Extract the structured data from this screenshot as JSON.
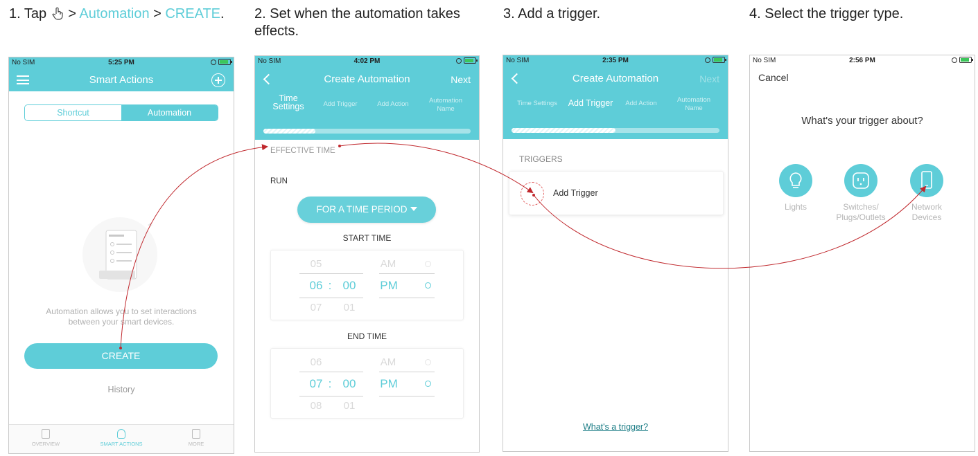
{
  "steps": {
    "s1": {
      "prefix": "1. Tap ",
      "sep1": " > ",
      "automation": "Automation",
      "sep2": " > ",
      "create": "CREATE",
      "suffix": "."
    },
    "s2": {
      "line1": "2. Set when the automation takes",
      "line2": "effects."
    },
    "s3": "3. Add a trigger.",
    "s4": "4. Select the trigger type."
  },
  "phone1": {
    "status": {
      "carrier": "No SIM",
      "time": "5:25 PM"
    },
    "title": "Smart Actions",
    "segments": [
      "Shortcut",
      "Automation"
    ],
    "description_line1": "Automation allows you to set interactions",
    "description_line2": "between your smart devices.",
    "create_label": "CREATE",
    "history_label": "History",
    "tabs": [
      "OVERVIEW",
      "SMART ACTIONS",
      "MORE"
    ]
  },
  "phone2": {
    "status": {
      "carrier": "No SIM",
      "time": "4:02 PM"
    },
    "title": "Create Automation",
    "next": "Next",
    "steps": {
      "time_line1": "Time",
      "time_line2": "Settings",
      "add_trigger": "Add Trigger",
      "add_action": "Add Action",
      "name_line1": "Automation",
      "name_line2": "Name"
    },
    "progress": 0.25,
    "effective_time": "EFFECTIVE TIME",
    "run": "RUN",
    "period_button": "FOR A TIME PERIOD",
    "start_time": {
      "label": "START TIME",
      "prev": {
        "hour": "05",
        "ampm": "AM"
      },
      "current": {
        "hour": "06",
        "min": "00",
        "ampm": "PM"
      },
      "next": {
        "hour": "07",
        "min": "01"
      }
    },
    "end_time": {
      "label": "END TIME",
      "prev": {
        "hour": "06",
        "ampm": "AM"
      },
      "current": {
        "hour": "07",
        "min": "00",
        "ampm": "PM"
      },
      "next": {
        "hour": "08",
        "min": "01"
      }
    },
    "colon": ":"
  },
  "phone3": {
    "status": {
      "carrier": "No SIM",
      "time": "2:35 PM"
    },
    "title": "Create Automation",
    "next": "Next",
    "steps": {
      "time_settings": "Time Settings",
      "add_trigger": "Add Trigger",
      "add_action": "Add Action",
      "name_line1": "Automation",
      "name_line2": "Name"
    },
    "progress": 0.5,
    "triggers_label": "TRIGGERS",
    "add_trigger": "Add Trigger",
    "help_link": "What's a trigger?"
  },
  "phone4": {
    "status": {
      "carrier": "No SIM",
      "time": "2:56 PM"
    },
    "cancel": "Cancel",
    "question": "What's your trigger about?",
    "options": [
      {
        "line1": "Lights",
        "line2": "",
        "icon": "bulb-icon"
      },
      {
        "line1": "Switches/",
        "line2": "Plugs/Outlets",
        "icon": "plug-icon"
      },
      {
        "line1": "Network",
        "line2": "Devices",
        "icon": "device-icon"
      }
    ]
  },
  "colors": {
    "accent": "#5ecdd8",
    "arrow": "#c0282d",
    "muted": "#b5b5b5"
  }
}
